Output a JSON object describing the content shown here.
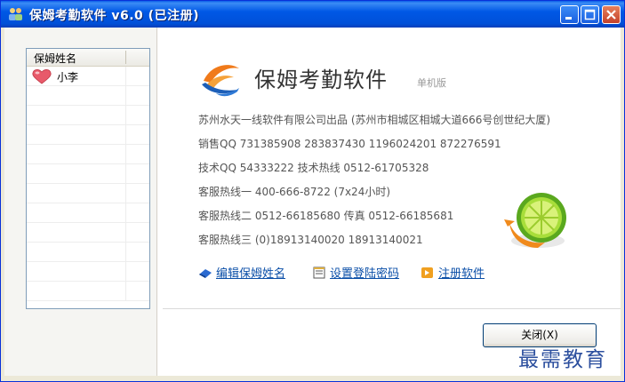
{
  "window": {
    "title": "保姆考勤软件 v6.0 (已注册)",
    "icon": "people-icon",
    "buttons": {
      "minimize": "minimize-icon",
      "maximize": "maximize-icon",
      "close": "close-icon"
    }
  },
  "list": {
    "column_header": "保姆姓名",
    "rows": [
      {
        "name": "小李",
        "icon": "heart-icon"
      }
    ]
  },
  "app": {
    "name": "保姆考勤软件",
    "edition": "单机版"
  },
  "info": {
    "company": "苏州水天一线软件有限公司出品 (苏州市相城区相城大道666号创世纪大厦)",
    "sales_qq": "销售QQ 731385908   283837430   1196024201   872276591",
    "tech": "技术QQ 54333222   技术热线 0512-61705328",
    "hotline1": "客服热线一 400-666-8722   (7x24小时)",
    "hotline2": "客服热线二 0512-66185680   传真 0512-66185681",
    "hotline3": "客服热线三 (0)18913140020  18913140021"
  },
  "links": {
    "edit_name": "编辑保姆姓名",
    "set_password": "设置登陆密码",
    "register": "注册软件"
  },
  "close_button": {
    "label": "关闭",
    "shortcut": "(X)"
  },
  "watermark": "最需教育",
  "colors": {
    "titlebar": "#0058e6",
    "link": "#0b4fa8",
    "watermark": "#2c4f9e"
  }
}
